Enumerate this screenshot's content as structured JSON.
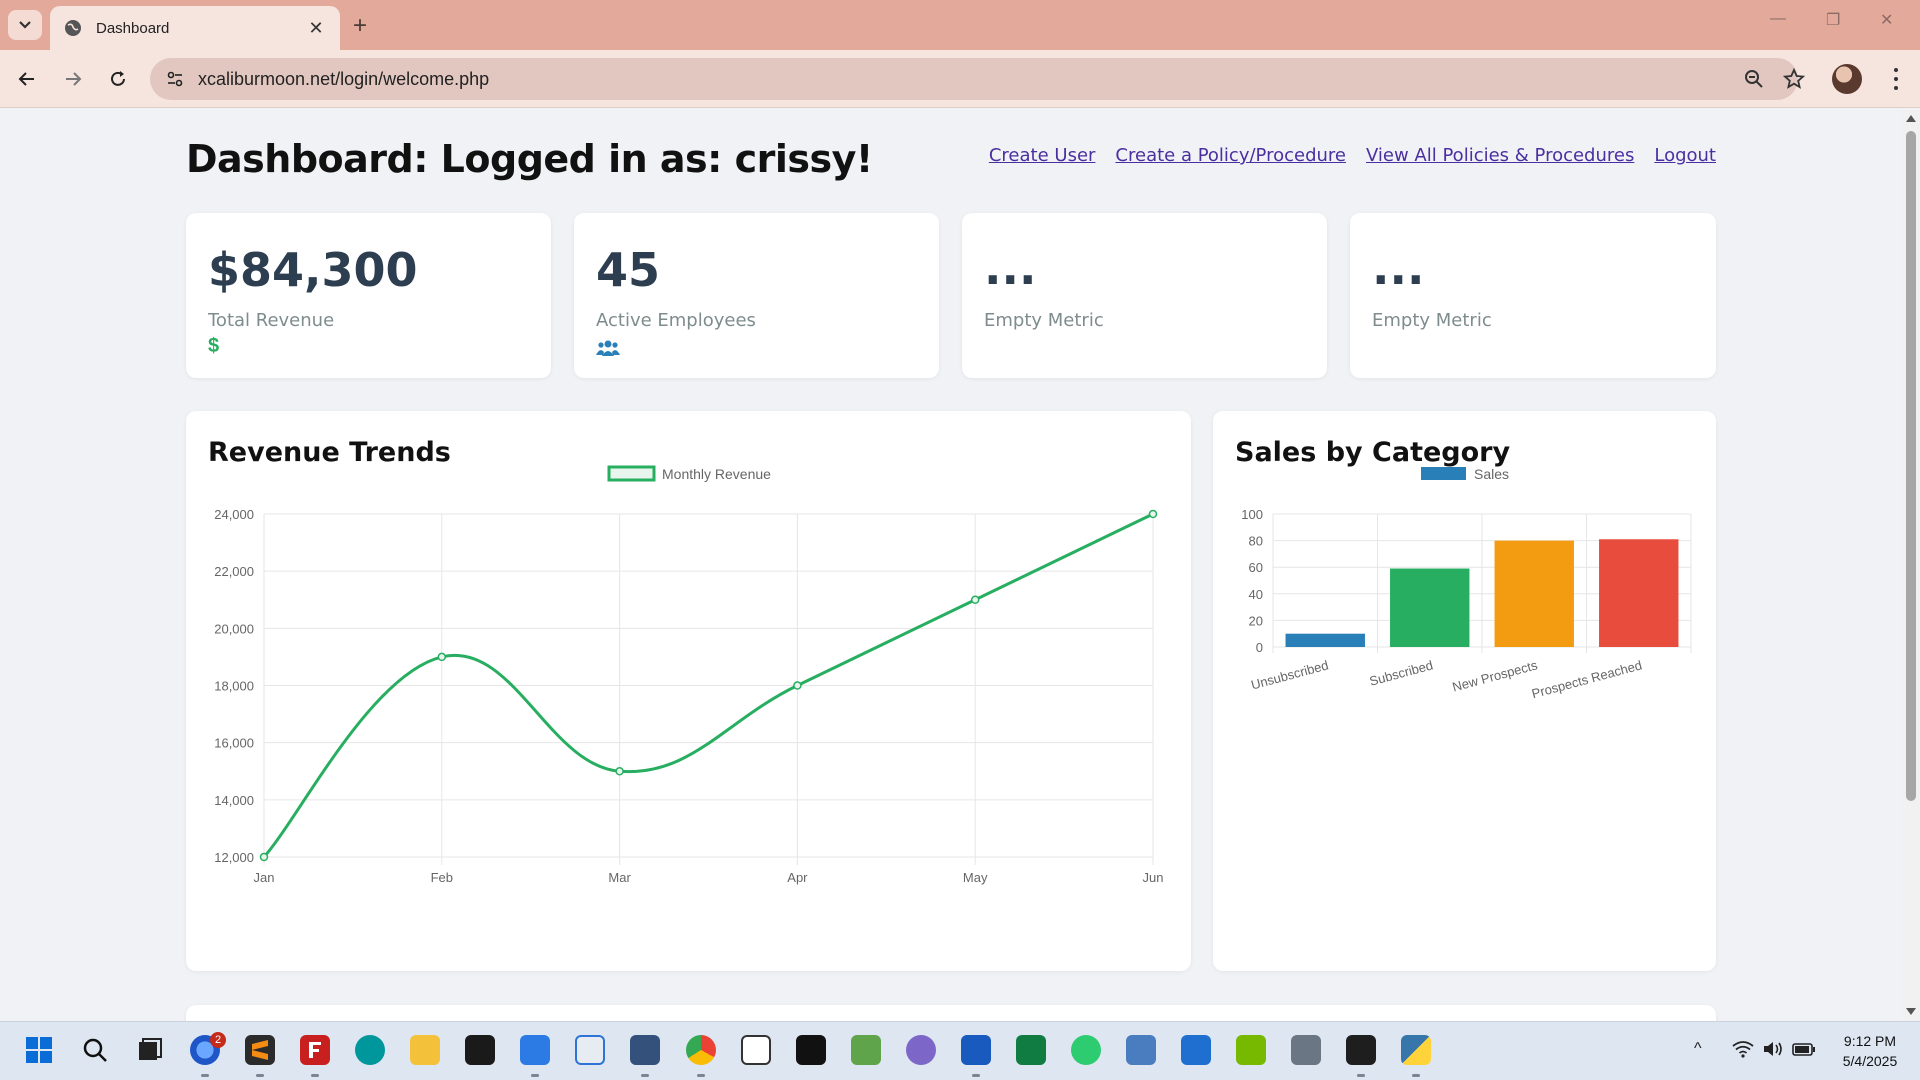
{
  "browser": {
    "tab_title": "Dashboard",
    "url": "xcaliburmoon.net/login/welcome.php"
  },
  "page": {
    "title": "Dashboard: Logged in as: crissy!",
    "nav": [
      "Create User",
      "Create a Policy/Procedure",
      "View All Policies & Procedures",
      "Logout"
    ]
  },
  "metrics": [
    {
      "value": "$84,300",
      "label": "Total Revenue",
      "icon": "dollar-icon",
      "icon_glyph": "$",
      "icon_color": "#27ae60"
    },
    {
      "value": "45",
      "label": "Active Employees",
      "icon": "users-icon",
      "icon_glyph": "",
      "icon_color": "#2980b9"
    },
    {
      "value": "...",
      "label": "Empty Metric",
      "icon": "",
      "icon_glyph": "",
      "icon_color": ""
    },
    {
      "value": "...",
      "label": "Empty Metric",
      "icon": "",
      "icon_glyph": "",
      "icon_color": ""
    }
  ],
  "charts": {
    "revenue_title": "Revenue Trends",
    "sales_title": "Sales by Category"
  },
  "chart_data": [
    {
      "type": "line",
      "title": "Revenue Trends",
      "categories": [
        "Jan",
        "Feb",
        "Mar",
        "Apr",
        "May",
        "Jun"
      ],
      "series": [
        {
          "name": "Monthly Revenue",
          "values": [
            12000,
            19000,
            15000,
            18000,
            21000,
            24000
          ],
          "color": "#27ae60"
        }
      ],
      "ylim": [
        12000,
        24000
      ],
      "yticks": [
        12000,
        14000,
        16000,
        18000,
        20000,
        22000,
        24000
      ],
      "ytick_labels": [
        "12,000",
        "14,000",
        "16,000",
        "18,000",
        "20,000",
        "22,000",
        "24,000"
      ],
      "grid": true,
      "legend": "top-center"
    },
    {
      "type": "bar",
      "title": "Sales by Category",
      "categories": [
        "Unsubscribed",
        "Subscribed",
        "New Prospects",
        "Prospects Reached"
      ],
      "series": [
        {
          "name": "Sales",
          "values": [
            10,
            59,
            80,
            81
          ]
        }
      ],
      "colors": [
        "#2980b9",
        "#27ae60",
        "#f39c12",
        "#e74c3c"
      ],
      "legend_color": "#2980b9",
      "ylim": [
        0,
        100
      ],
      "yticks": [
        0,
        20,
        40,
        60,
        80,
        100
      ],
      "grid": true,
      "legend": "top-center"
    }
  ],
  "taskbar": {
    "badge_count": "2",
    "time": "9:12 PM",
    "date": "5/4/2025"
  }
}
